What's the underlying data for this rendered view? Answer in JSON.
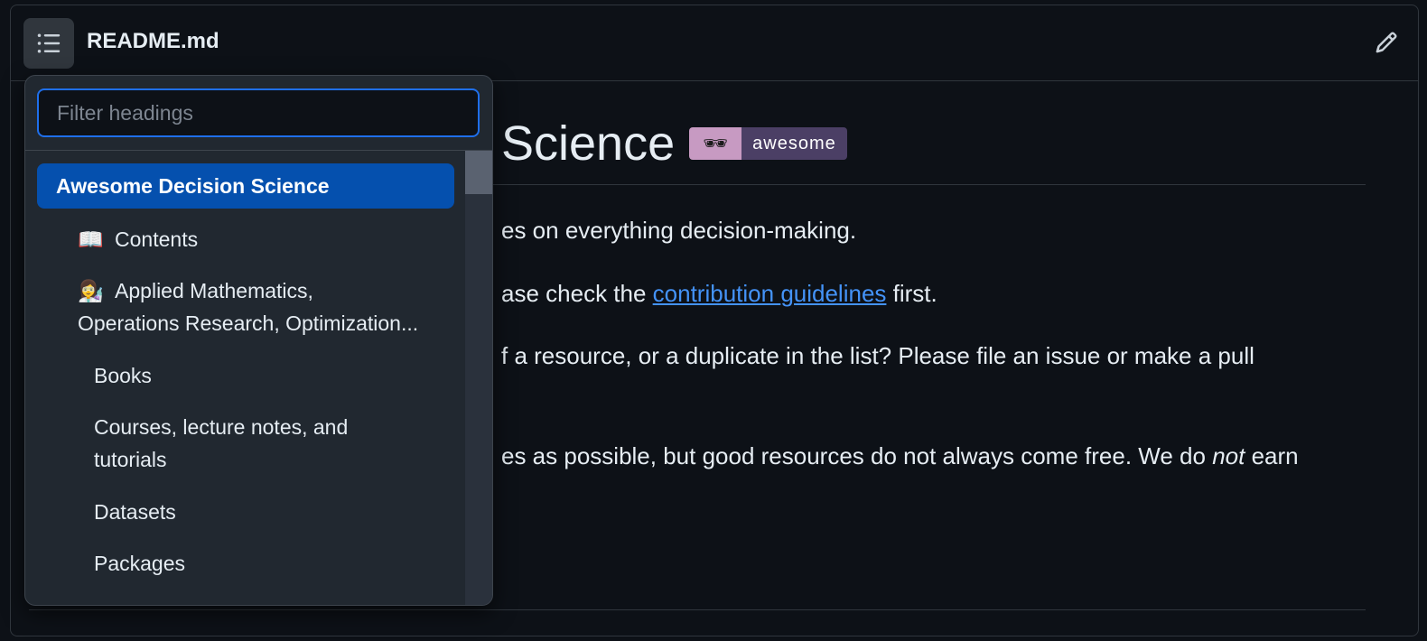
{
  "header": {
    "file_name": "README.md",
    "outline_icon": "list-unordered-icon",
    "edit_icon": "pencil-icon"
  },
  "content": {
    "heading_visible": "Science",
    "badge": {
      "icon": "sunglasses-icon",
      "glyph": "🕶",
      "label": "awesome",
      "left_color": "#c79ac2",
      "right_color": "#4b3f65"
    },
    "paragraphs": [
      {
        "text": "es on everything decision-making."
      },
      {
        "before": "ase check the ",
        "link1": "contribution ",
        "link2": "guidelines",
        "after": " first."
      },
      {
        "text": "f a resource, or a duplicate in the list? Please file an issue or make a pull"
      },
      {
        "before": "es as possible, but good resources do not always come free. We do ",
        "em": "not",
        "after": " earn"
      }
    ]
  },
  "outline": {
    "filter_placeholder": "Filter headings",
    "filter_value": "",
    "items": [
      {
        "label": "Awesome Decision Science",
        "selected": true
      },
      {
        "emoji": "📖",
        "label": "Contents"
      },
      {
        "emoji": "👩‍🔬",
        "label": "Applied Mathematics,",
        "label_line2": "Operations Research, Optimization..."
      },
      {
        "label": "Books"
      },
      {
        "label": "Courses, lecture notes, and",
        "label_line2": "tutorials"
      },
      {
        "label": "Datasets"
      },
      {
        "label": "Packages"
      }
    ]
  },
  "colors": {
    "background": "#0d1117",
    "panel": "#212830",
    "selected": "#0550ae",
    "link": "#4493f8",
    "focus_border": "#1f6feb"
  }
}
